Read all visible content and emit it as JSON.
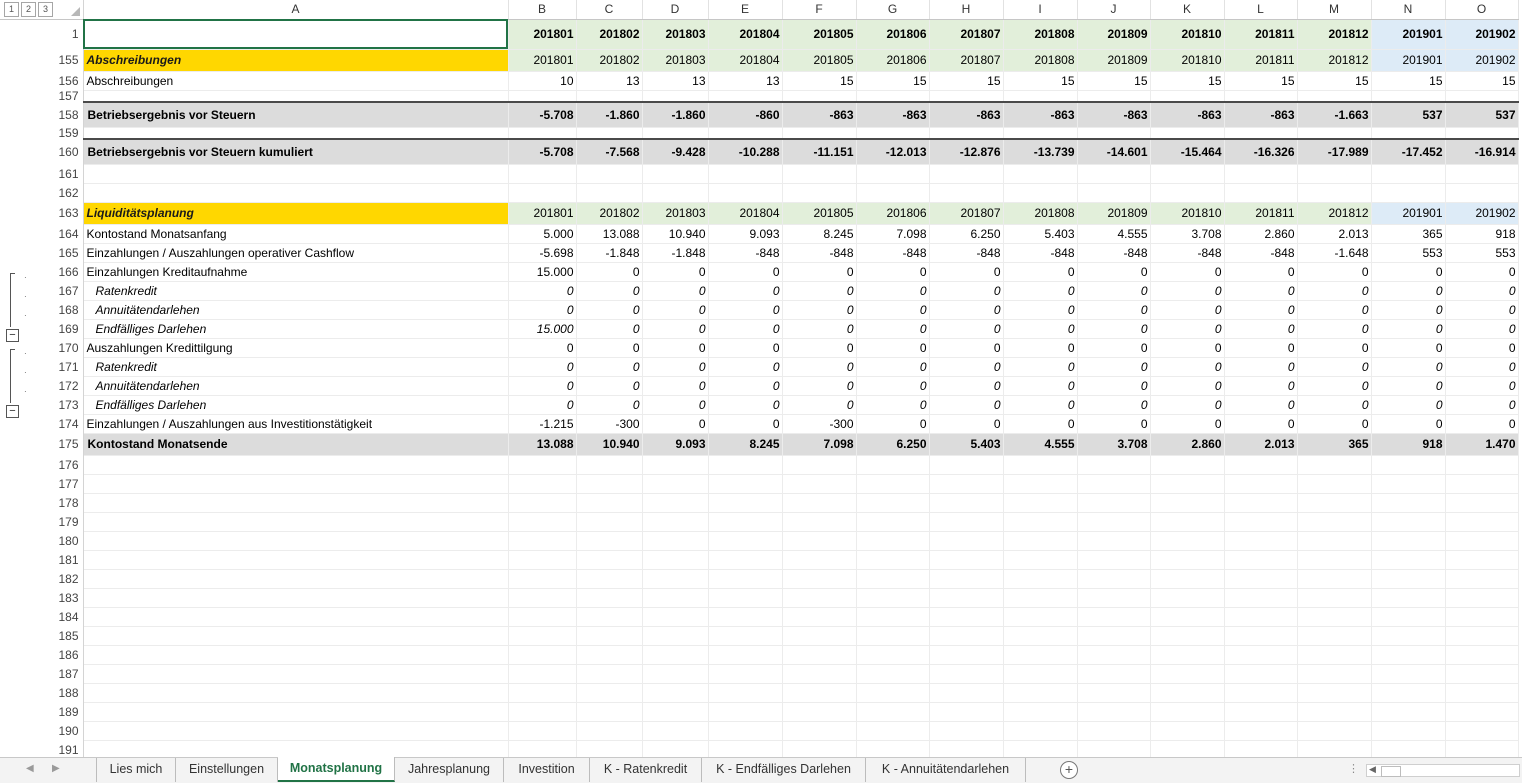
{
  "outline_levels": [
    "1",
    "2",
    "3"
  ],
  "name_box_value": "",
  "columns": [
    "A",
    "B",
    "C",
    "D",
    "E",
    "F",
    "G",
    "H",
    "I",
    "J",
    "K",
    "L",
    "M",
    "N",
    "O"
  ],
  "header_row": {
    "row_number": "1",
    "periods": [
      "201801",
      "201802",
      "201803",
      "201804",
      "201805",
      "201806",
      "201807",
      "201808",
      "201809",
      "201810",
      "201811",
      "201812",
      "201901",
      "201902"
    ]
  },
  "rows": [
    {
      "n": "155",
      "kind": "sechead",
      "label": "Abschreibungen",
      "values": [
        "201801",
        "201802",
        "201803",
        "201804",
        "201805",
        "201806",
        "201807",
        "201808",
        "201809",
        "201810",
        "201811",
        "201812",
        "201901",
        "201902"
      ]
    },
    {
      "n": "156",
      "kind": "norm",
      "label": "Abschreibungen",
      "values": [
        "10",
        "13",
        "13",
        "13",
        "15",
        "15",
        "15",
        "15",
        "15",
        "15",
        "15",
        "15",
        "15",
        "15"
      ]
    },
    {
      "n": "157",
      "kind": "spacer"
    },
    {
      "n": "158",
      "kind": "big",
      "label": "Betriebsergebnis vor Steuern",
      "values": [
        "-5.708",
        "-1.860",
        "-1.860",
        "-860",
        "-863",
        "-863",
        "-863",
        "-863",
        "-863",
        "-863",
        "-863",
        "-1.663",
        "537",
        "537"
      ]
    },
    {
      "n": "159",
      "kind": "spacer"
    },
    {
      "n": "160",
      "kind": "big",
      "label": "Betriebsergebnis vor Steuern kumuliert",
      "values": [
        "-5.708",
        "-7.568",
        "-9.428",
        "-10.288",
        "-11.151",
        "-12.013",
        "-12.876",
        "-13.739",
        "-14.601",
        "-15.464",
        "-16.326",
        "-17.989",
        "-17.452",
        "-16.914"
      ]
    },
    {
      "n": "161",
      "kind": "empty"
    },
    {
      "n": "162",
      "kind": "empty"
    },
    {
      "n": "163",
      "kind": "sechead",
      "label": "Liquiditätsplanung",
      "values": [
        "201801",
        "201802",
        "201803",
        "201804",
        "201805",
        "201806",
        "201807",
        "201808",
        "201809",
        "201810",
        "201811",
        "201812",
        "201901",
        "201902"
      ]
    },
    {
      "n": "164",
      "kind": "norm",
      "label": "Kontostand Monatsanfang",
      "values": [
        "5.000",
        "13.088",
        "10.940",
        "9.093",
        "8.245",
        "7.098",
        "6.250",
        "5.403",
        "4.555",
        "3.708",
        "2.860",
        "2.013",
        "365",
        "918"
      ]
    },
    {
      "n": "165",
      "kind": "norm",
      "label": "Einzahlungen / Auszahlungen operativer Cashflow",
      "values": [
        "-5.698",
        "-1.848",
        "-1.848",
        "-848",
        "-848",
        "-848",
        "-848",
        "-848",
        "-848",
        "-848",
        "-848",
        "-1.648",
        "553",
        "553"
      ]
    },
    {
      "n": "166",
      "kind": "norm",
      "label": "Einzahlungen Kreditaufnahme",
      "values": [
        "15.000",
        "0",
        "0",
        "0",
        "0",
        "0",
        "0",
        "0",
        "0",
        "0",
        "0",
        "0",
        "0",
        "0"
      ]
    },
    {
      "n": "167",
      "kind": "sub",
      "label": "Ratenkredit",
      "values": [
        "0",
        "0",
        "0",
        "0",
        "0",
        "0",
        "0",
        "0",
        "0",
        "0",
        "0",
        "0",
        "0",
        "0"
      ]
    },
    {
      "n": "168",
      "kind": "sub",
      "label": "Annuitätendarlehen",
      "values": [
        "0",
        "0",
        "0",
        "0",
        "0",
        "0",
        "0",
        "0",
        "0",
        "0",
        "0",
        "0",
        "0",
        "0"
      ]
    },
    {
      "n": "169",
      "kind": "sub",
      "label": "Endfälliges Darlehen",
      "values": [
        "15.000",
        "0",
        "0",
        "0",
        "0",
        "0",
        "0",
        "0",
        "0",
        "0",
        "0",
        "0",
        "0",
        "0"
      ]
    },
    {
      "n": "170",
      "kind": "norm",
      "label": "Auszahlungen Kredittilgung",
      "values": [
        "0",
        "0",
        "0",
        "0",
        "0",
        "0",
        "0",
        "0",
        "0",
        "0",
        "0",
        "0",
        "0",
        "0"
      ]
    },
    {
      "n": "171",
      "kind": "sub",
      "label": "Ratenkredit",
      "values": [
        "0",
        "0",
        "0",
        "0",
        "0",
        "0",
        "0",
        "0",
        "0",
        "0",
        "0",
        "0",
        "0",
        "0"
      ]
    },
    {
      "n": "172",
      "kind": "sub",
      "label": "Annuitätendarlehen",
      "values": [
        "0",
        "0",
        "0",
        "0",
        "0",
        "0",
        "0",
        "0",
        "0",
        "0",
        "0",
        "0",
        "0",
        "0"
      ]
    },
    {
      "n": "173",
      "kind": "sub",
      "label": "Endfälliges Darlehen",
      "values": [
        "0",
        "0",
        "0",
        "0",
        "0",
        "0",
        "0",
        "0",
        "0",
        "0",
        "0",
        "0",
        "0",
        "0"
      ]
    },
    {
      "n": "174",
      "kind": "norm",
      "label": "Einzahlungen / Auszahlungen aus Investitionstätigkeit",
      "values": [
        "-1.215",
        "-300",
        "0",
        "0",
        "-300",
        "0",
        "0",
        "0",
        "0",
        "0",
        "0",
        "0",
        "0",
        "0"
      ]
    },
    {
      "n": "175",
      "kind": "total",
      "label": "Kontostand Monatsende",
      "values": [
        "13.088",
        "10.940",
        "9.093",
        "8.245",
        "7.098",
        "6.250",
        "5.403",
        "4.555",
        "3.708",
        "2.860",
        "2.013",
        "365",
        "918",
        "1.470"
      ]
    },
    {
      "n": "176",
      "kind": "empty"
    },
    {
      "n": "177",
      "kind": "empty"
    },
    {
      "n": "178",
      "kind": "empty"
    },
    {
      "n": "179",
      "kind": "empty"
    },
    {
      "n": "180",
      "kind": "empty"
    },
    {
      "n": "181",
      "kind": "empty"
    },
    {
      "n": "182",
      "kind": "empty"
    },
    {
      "n": "183",
      "kind": "empty"
    },
    {
      "n": "184",
      "kind": "empty"
    },
    {
      "n": "185",
      "kind": "empty"
    },
    {
      "n": "186",
      "kind": "empty"
    },
    {
      "n": "187",
      "kind": "empty"
    },
    {
      "n": "188",
      "kind": "empty"
    },
    {
      "n": "189",
      "kind": "empty"
    },
    {
      "n": "190",
      "kind": "empty"
    },
    {
      "n": "191",
      "kind": "empty"
    }
  ],
  "sheet_tabs": [
    "Lies mich",
    "Einstellungen",
    "Monatsplanung",
    "Jahresplanung",
    "Investition",
    "K - Ratenkredit",
    "K - Endfälliges Darlehen",
    "K - Annuitätendarlehen"
  ],
  "active_tab": "Monatsplanung",
  "add_sheet_symbol": "+",
  "colors": {
    "green_fill": "#e2efda",
    "blue_fill": "#ddebf7",
    "yellow_fill": "#ffd700",
    "gray_fill": "#dcdcdc",
    "active_tab_text": "#217346"
  }
}
